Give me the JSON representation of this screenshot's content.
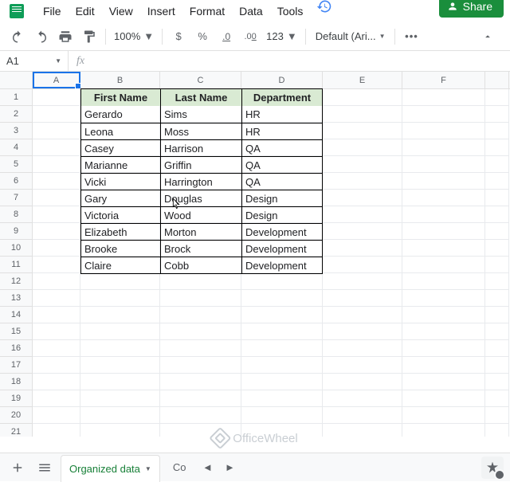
{
  "menu": {
    "file": "File",
    "edit": "Edit",
    "view": "View",
    "insert": "Insert",
    "format": "Format",
    "data": "Data",
    "tools": "Tools"
  },
  "share": {
    "label": "Share"
  },
  "toolbar": {
    "zoom": "100%",
    "currency": "$",
    "percent": "%",
    "decimals_dec": ".0",
    "decimals_inc": ".00",
    "num_format": "123",
    "font": "Default (Ari...",
    "more": "•••"
  },
  "cellref": {
    "name": "A1",
    "fx": "fx"
  },
  "cols": [
    "A",
    "B",
    "C",
    "D",
    "E",
    "F"
  ],
  "rows": [
    "1",
    "2",
    "3",
    "4",
    "5",
    "6",
    "7",
    "8",
    "9",
    "10",
    "11",
    "12",
    "13",
    "14",
    "15",
    "16",
    "17",
    "18",
    "19",
    "20",
    "21"
  ],
  "table": {
    "headers": {
      "first": "First Name",
      "last": "Last Name",
      "dept": "Department"
    },
    "data": [
      {
        "first": "Gerardo",
        "last": "Sims",
        "dept": "HR"
      },
      {
        "first": "Leona",
        "last": "Moss",
        "dept": "HR"
      },
      {
        "first": "Casey",
        "last": "Harrison",
        "dept": "QA"
      },
      {
        "first": "Marianne",
        "last": "Griffin",
        "dept": "QA"
      },
      {
        "first": "Vicki",
        "last": "Harrington",
        "dept": "QA"
      },
      {
        "first": "Gary",
        "last": "Douglas",
        "dept": "Design"
      },
      {
        "first": "Victoria",
        "last": "Wood",
        "dept": "Design"
      },
      {
        "first": "Elizabeth",
        "last": "Morton",
        "dept": "Development"
      },
      {
        "first": "Brooke",
        "last": "Brock",
        "dept": "Development"
      },
      {
        "first": "Claire",
        "last": "Cobb",
        "dept": "Development"
      }
    ]
  },
  "sheets": {
    "active": "Organized data",
    "partial": "Co"
  },
  "watermark": "OfficeWheel"
}
